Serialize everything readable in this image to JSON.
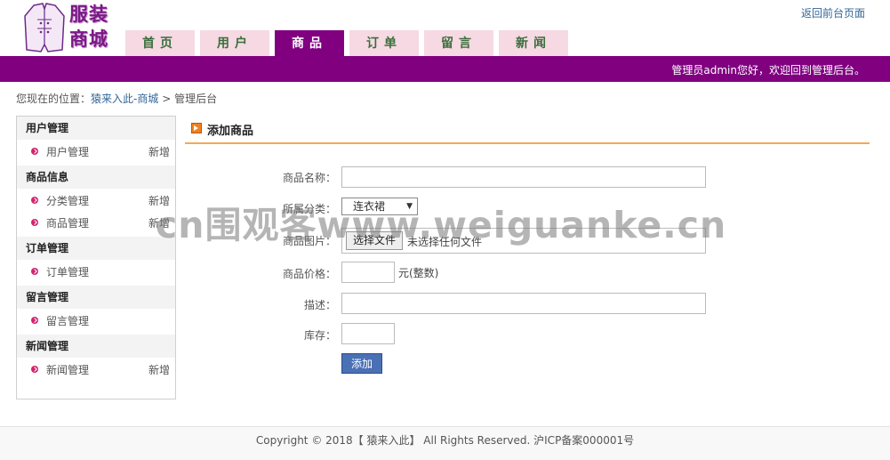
{
  "header": {
    "logo_line1": "服装",
    "logo_line2": "商城",
    "back_link": "返回前台页面",
    "welcome": "管理员admin您好，欢迎回到管理后台。"
  },
  "nav": {
    "tabs": [
      "首页",
      "用户",
      "商品",
      "订单",
      "留言",
      "新闻"
    ],
    "active_index": 2
  },
  "breadcrumb": {
    "prefix": "您现在的位置：",
    "site": "猿来入此-商城",
    "sep": ">",
    "current": "管理后台"
  },
  "sidebar": {
    "groups": [
      {
        "title": "用户管理",
        "items": [
          {
            "label": "用户管理",
            "new": "新增"
          }
        ]
      },
      {
        "title": "商品信息",
        "items": [
          {
            "label": "分类管理",
            "new": "新增"
          },
          {
            "label": "商品管理",
            "new": "新增"
          }
        ]
      },
      {
        "title": "订单管理",
        "items": [
          {
            "label": "订单管理",
            "new": ""
          }
        ]
      },
      {
        "title": "留言管理",
        "items": [
          {
            "label": "留言管理",
            "new": ""
          }
        ]
      },
      {
        "title": "新闻管理",
        "items": [
          {
            "label": "新闻管理",
            "new": "新增"
          }
        ]
      }
    ]
  },
  "form": {
    "title": "添加商品",
    "name_label": "商品名称：",
    "name_value": "",
    "category_label": "所属分类：",
    "category_value": "连衣裙",
    "image_label": "商品图片：",
    "file_button": "选择文件",
    "file_status": "未选择任何文件",
    "price_label": "商品价格：",
    "price_value": "",
    "price_unit": "元(整数)",
    "desc_label": "描述：",
    "desc_value": "",
    "stock_label": "库存：",
    "stock_value": "",
    "submit": "添加"
  },
  "watermark": "cn围观客www.weiguanke.cn",
  "footer": "Copyright © 2018【 猿来入此】 All Rights Reserved. 沪ICP备案000001号",
  "colors": {
    "brand_purple": "#800080",
    "tab_pink": "#f6d9e3",
    "accent_orange": "#f6a851",
    "button_blue": "#4a70b5"
  }
}
